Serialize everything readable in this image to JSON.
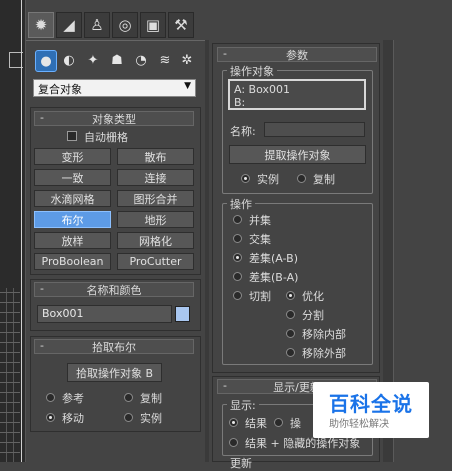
{
  "tabs": [
    {
      "icon": "create-icon",
      "glyph": "✹"
    },
    {
      "icon": "modify-icon",
      "glyph": "◢"
    },
    {
      "icon": "hierarchy-icon",
      "glyph": "♙"
    },
    {
      "icon": "motion-icon",
      "glyph": "◎"
    },
    {
      "icon": "display-icon",
      "glyph": "▣"
    },
    {
      "icon": "utilities-icon",
      "glyph": "⚒"
    }
  ],
  "subtabs": [
    {
      "icon": "geometry-icon",
      "glyph": "●"
    },
    {
      "icon": "shapes-icon",
      "glyph": "◐"
    },
    {
      "icon": "lights-icon",
      "glyph": "✦"
    },
    {
      "icon": "cameras-icon",
      "glyph": "☗"
    },
    {
      "icon": "helpers-icon",
      "glyph": "◔"
    },
    {
      "icon": "spacewarps-icon",
      "glyph": "≋"
    },
    {
      "icon": "systems-icon",
      "glyph": "✲"
    }
  ],
  "category_select": {
    "value": "复合对象"
  },
  "object_type": {
    "title": "对象类型",
    "autogrid": "自动栅格",
    "buttons": [
      "变形",
      "散布",
      "一致",
      "连接",
      "水滴网格",
      "图形合并",
      "布尔",
      "地形",
      "放样",
      "网格化",
      "ProBoolean",
      "ProCutter"
    ]
  },
  "name_color": {
    "title": "名称和颜色",
    "name": "Box001",
    "color": "#a9c7f0"
  },
  "pick_boolean": {
    "title": "拾取布尔",
    "pick_button": "拾取操作对象 B",
    "options": [
      "参考",
      "复制",
      "移动",
      "实例"
    ]
  },
  "parameters": {
    "title": "参数",
    "operands": {
      "title": "操作对象",
      "a": "A: Box001",
      "b": "B:",
      "name_label": "名称:",
      "extract": "提取操作对象",
      "instance": "实例",
      "copy": "复制"
    },
    "operation": {
      "title": "操作",
      "union": "并集",
      "intersection": "交集",
      "sub_ab": "差集(A-B)",
      "sub_ba": "差集(B-A)",
      "cut": "切割",
      "refine": "优化",
      "split": "分割",
      "remove_inside": "移除内部",
      "remove_outside": "移除外部"
    }
  },
  "display": {
    "title": "显示/更新",
    "display_label": "显示:",
    "result": "结果",
    "operands_trunc": "操",
    "result_hidden": "结果 + 隐藏的操作对象",
    "update_trunc": "更新"
  },
  "watermark": {
    "brand": "百科全说",
    "tagline": "助你轻松解决"
  }
}
